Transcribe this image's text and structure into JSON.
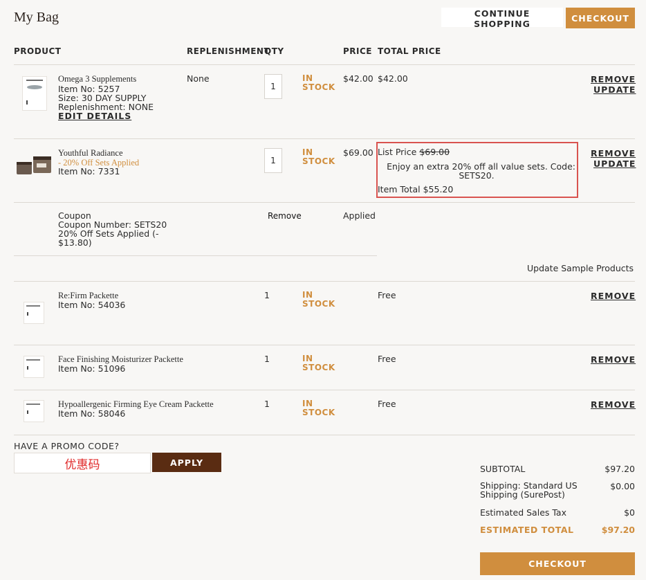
{
  "header": {
    "title": "My Bag",
    "continue_label": "CONTINUE SHOPPING",
    "checkout_label": "CHECKOUT"
  },
  "columns": {
    "product": "PRODUCT",
    "replenishment": "REPLENISHMENT",
    "qty": "QTY",
    "price": "PRICE",
    "total_price": "TOTAL PRICE"
  },
  "items": [
    {
      "name": "Omega 3 Supplements",
      "item_no": "Item No: 5257",
      "size": "Size: 30 DAY SUPPLY",
      "replenishment_line": "Replenishment: NONE",
      "edit_label": "EDIT DETAILS",
      "replenishment": "None",
      "qty": "1",
      "stock": [
        "IN",
        "STOCK"
      ],
      "price": "$42.00",
      "total": "$42.00",
      "remove_label": "REMOVE",
      "update_label": "UPDATE"
    },
    {
      "name": "Youthful Radiance",
      "promo_line": "- 20% Off Sets Applied",
      "item_no": "Item No: 7331",
      "qty": "1",
      "stock": [
        "IN",
        "STOCK"
      ],
      "price": "$69.00",
      "list_price_label": "List Price",
      "list_price": "$69.00",
      "offer_line1": "Enjoy an extra 20% off all value sets. Code:",
      "offer_line2": "SETS20.",
      "item_total": "Item Total $55.20",
      "remove_label": "REMOVE",
      "update_label": "UPDATE"
    }
  ],
  "coupon": {
    "label": "Coupon",
    "number": "Coupon Number: SETS20",
    "desc1": "20% Off Sets Applied (-",
    "desc2": "$13.80)",
    "remove_label": "Remove",
    "status": "Applied"
  },
  "update_samples_label": "Update Sample Products",
  "samples": [
    {
      "name": "Re:Firm Packette",
      "item_no": "Item No: 54036",
      "qty": "1",
      "stock": [
        "IN",
        "STOCK"
      ],
      "price": "Free",
      "remove_label": "REMOVE"
    },
    {
      "name": "Face Finishing Moisturizer Packette",
      "item_no": "Item No: 51096",
      "qty": "1",
      "stock": [
        "IN",
        "STOCK"
      ],
      "price": "Free",
      "remove_label": "REMOVE"
    },
    {
      "name": "Hypoallergenic Firming Eye Cream Packette",
      "item_no": "Item No: 58046",
      "qty": "1",
      "stock": [
        "IN",
        "STOCK"
      ],
      "price": "Free",
      "remove_label": "REMOVE"
    }
  ],
  "promo": {
    "label": "HAVE A PROMO CODE?",
    "value": "优惠码",
    "apply_label": "APPLY"
  },
  "summary": {
    "subtotal_label": "SUBTOTAL",
    "subtotal": "$97.20",
    "shipping_label_1": "Shipping: Standard US",
    "shipping_label_2": "Shipping (SurePost)",
    "shipping": "$0.00",
    "tax_label": "Estimated Sales Tax",
    "tax": "$0",
    "total_label": "ESTIMATED TOTAL",
    "total": "$97.20",
    "checkout_label": "CHECKOUT"
  },
  "colors": {
    "accent": "#d08e3e",
    "apply_bg": "#5a2c12",
    "highlight": "#d9534f"
  }
}
